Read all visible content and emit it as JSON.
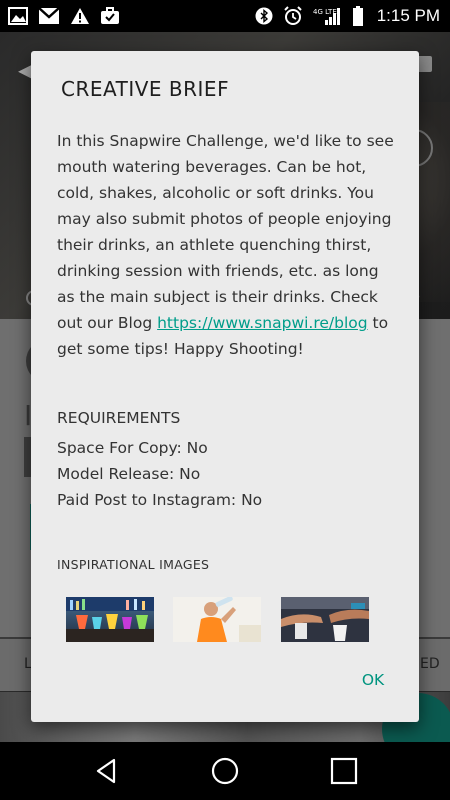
{
  "status_bar": {
    "time": "1:15 PM",
    "network_label": "4G LTE",
    "left_icons": [
      "image-icon",
      "gmail-icon",
      "warning-icon",
      "briefcase-icon"
    ],
    "right_icons": [
      "bluetooth-icon",
      "alarm-icon",
      "signal-icon",
      "battery-icon"
    ]
  },
  "background": {
    "tab_left": "L",
    "tab_right": "ED"
  },
  "dialog": {
    "title": "CREATIVE BRIEF",
    "brief_before_link": "In this Snapwire Challenge, we'd like to see mouth watering beverages. Can be hot, cold, shakes, alcoholic or soft drinks. You may also submit photos of people enjoying their drinks, an athlete quenching thirst, drinking session with friends, etc. as long as the main subject is their drinks. Check out our Blog ",
    "brief_link": "https://www.snapwi.re/blog",
    "brief_after_link": " to get some tips! Happy Shooting!",
    "requirements_heading": "REQUIREMENTS",
    "requirements": [
      {
        "label": "Space For Copy: No"
      },
      {
        "label": "Model Release: No"
      },
      {
        "label": "Paid Post to Instagram: No"
      }
    ],
    "inspirational_heading": "INSPIRATIONAL IMAGES",
    "images": [
      {
        "subject": "colorful cocktails on bar counter"
      },
      {
        "subject": "man drinking from bottle"
      },
      {
        "subject": "hands holding drinks"
      }
    ],
    "ok_label": "OK"
  },
  "colors": {
    "accent": "#009d8a",
    "dialog_bg": "#ebebeb",
    "text": "#333333"
  }
}
